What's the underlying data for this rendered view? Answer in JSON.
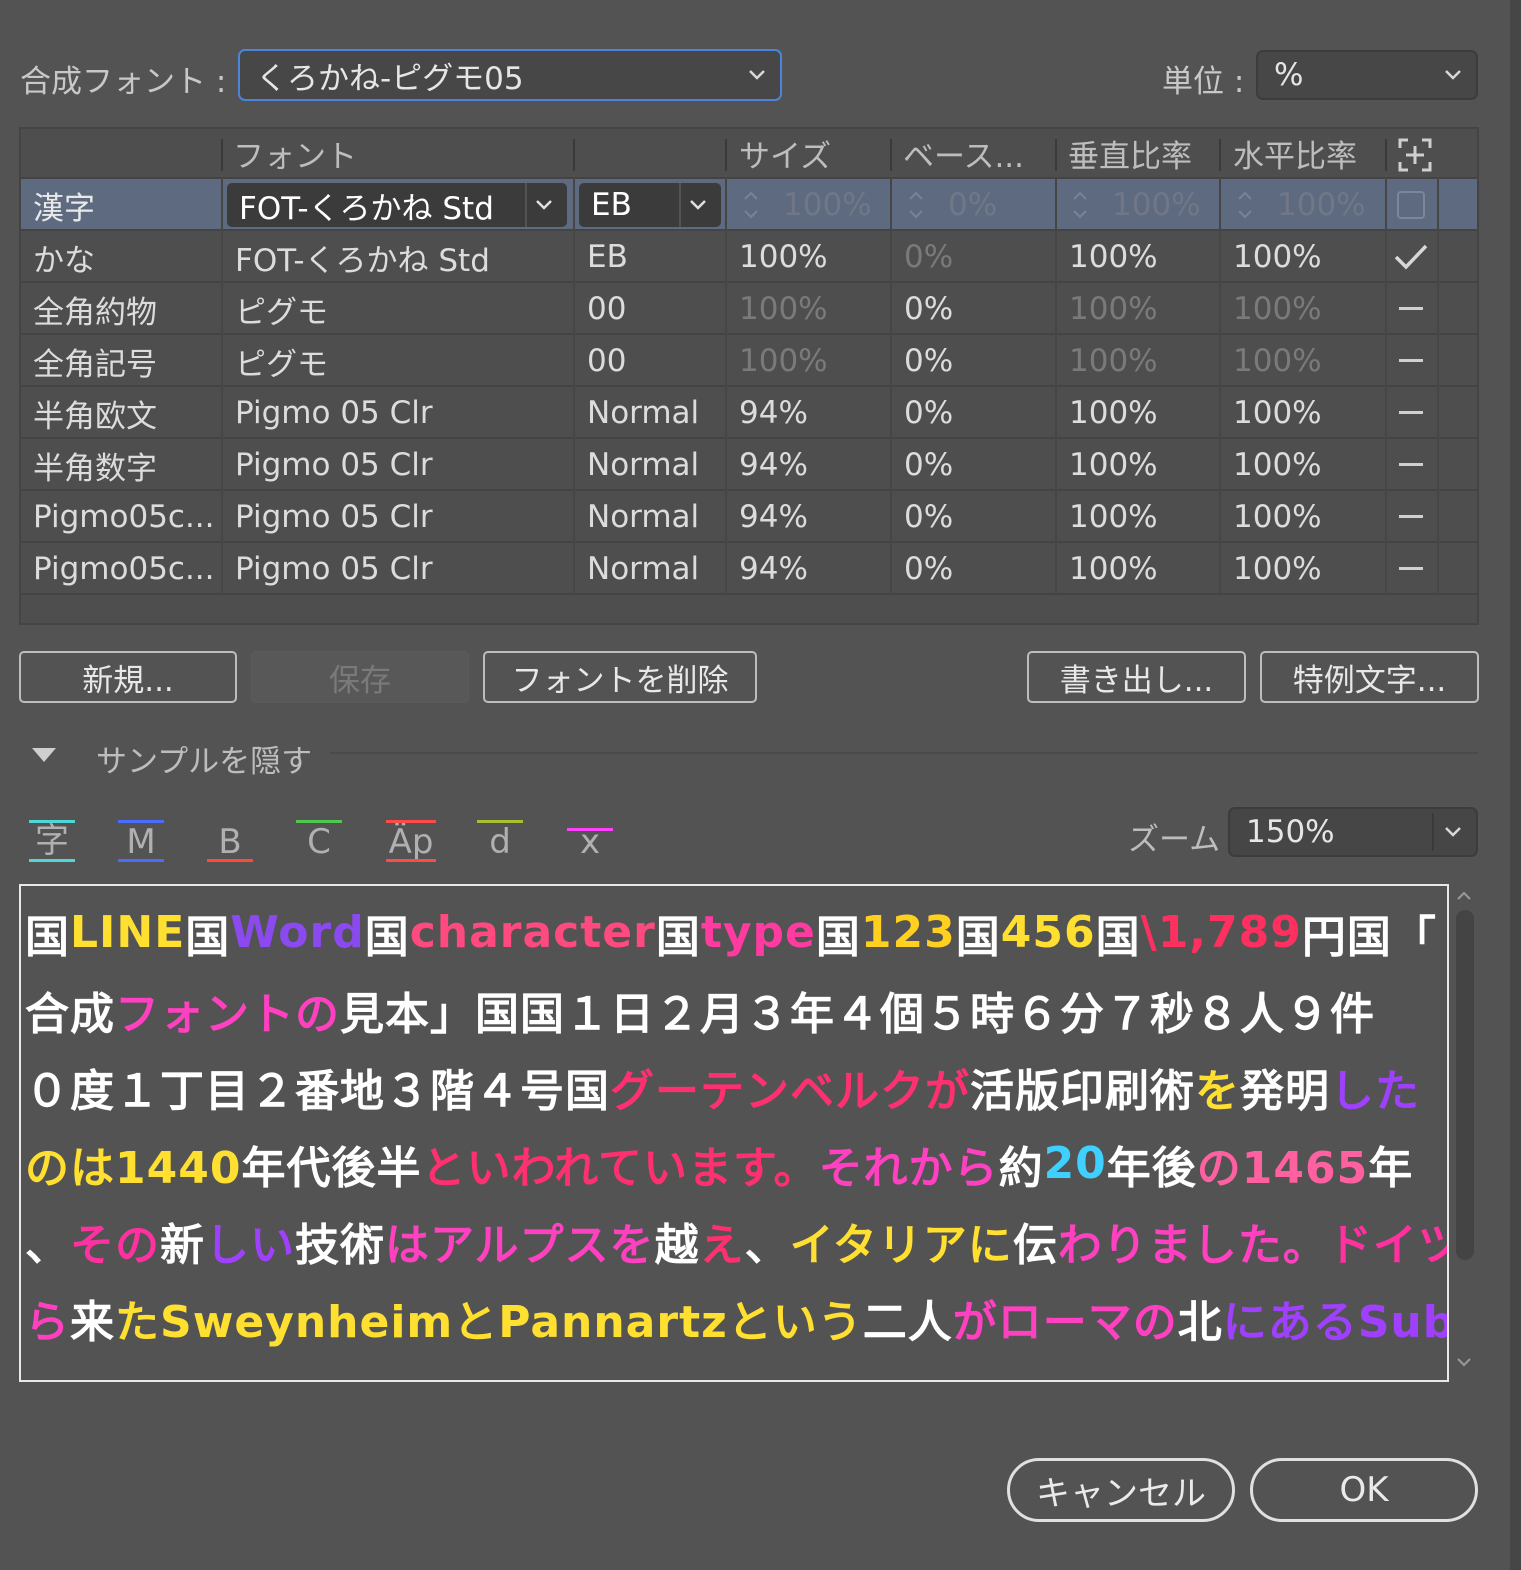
{
  "top": {
    "composite_font_label": "合成フォント :",
    "composite_font_value": "くろかね-ピグモ05",
    "unit_label": "単位 :",
    "unit_value": "%"
  },
  "table": {
    "headers": [
      "",
      "フォント",
      "",
      "サイズ",
      "ベース...",
      "垂直比率",
      "水平比率"
    ],
    "rows": [
      {
        "name": "漢字",
        "font": "FOT-くろかね Std",
        "style": "EB",
        "size": "100%",
        "base": "0%",
        "vscale": "100%",
        "hscale": "100%",
        "mark": "checkbox",
        "selected": true
      },
      {
        "name": "かな",
        "font": "FOT-くろかね Std",
        "style": "EB",
        "size": "100%",
        "base": "0%",
        "vscale": "100%",
        "hscale": "100%",
        "mark": "check"
      },
      {
        "name": "全角約物",
        "font": "ピグモ",
        "style": "00",
        "size": "100%",
        "base": "0%",
        "vscale": "100%",
        "hscale": "100%",
        "mark": "dash"
      },
      {
        "name": "全角記号",
        "font": "ピグモ",
        "style": "00",
        "size": "100%",
        "base": "0%",
        "vscale": "100%",
        "hscale": "100%",
        "mark": "dash"
      },
      {
        "name": "半角欧文",
        "font": "Pigmo 05 Clr",
        "style": "Normal",
        "size": "94%",
        "base": "0%",
        "vscale": "100%",
        "hscale": "100%",
        "mark": "dash"
      },
      {
        "name": "半角数字",
        "font": "Pigmo 05 Clr",
        "style": "Normal",
        "size": "94%",
        "base": "0%",
        "vscale": "100%",
        "hscale": "100%",
        "mark": "dash"
      },
      {
        "name": "Pigmo05c...",
        "font": "Pigmo 05 Clr",
        "style": "Normal",
        "size": "94%",
        "base": "0%",
        "vscale": "100%",
        "hscale": "100%",
        "mark": "dash"
      },
      {
        "name": "Pigmo05c...",
        "font": "Pigmo 05 Clr",
        "style": "Normal",
        "size": "94%",
        "base": "0%",
        "vscale": "100%",
        "hscale": "100%",
        "mark": "dash"
      }
    ]
  },
  "buttons": {
    "new": "新規...",
    "save": "保存",
    "delete_font": "フォントを削除",
    "export": "書き出し...",
    "special_chars": "特例文字..."
  },
  "sample": {
    "toggle_label": "サンプルを隠す",
    "tools": [
      "字",
      "M",
      "B",
      "C",
      "Äp",
      "d",
      "x"
    ],
    "zoom_label": "ズーム",
    "zoom_value": "150%",
    "lines": [
      [
        {
          "t": "国",
          "c": "#ffffff"
        },
        {
          "t": "LINE",
          "c": "#ffe030"
        },
        {
          "t": "国",
          "c": "#ffffff"
        },
        {
          "t": "Word",
          "c": "#8a4af0"
        },
        {
          "t": "国",
          "c": "#ffffff"
        },
        {
          "t": "character",
          "c": "#ff4a80"
        },
        {
          "t": "国",
          "c": "#ffffff"
        },
        {
          "t": "type",
          "c": "#ff3aa0"
        },
        {
          "t": "国",
          "c": "#ffffff"
        },
        {
          "t": "123",
          "c": "#ffd020"
        },
        {
          "t": "国",
          "c": "#ffffff"
        },
        {
          "t": "456",
          "c": "#ffe030"
        },
        {
          "t": "国",
          "c": "#ffffff"
        },
        {
          "t": "\\1,789",
          "c": "#ff3060"
        },
        {
          "t": "円国「",
          "c": "#ffffff"
        }
      ],
      [
        {
          "t": "合成",
          "c": "#ffffff"
        },
        {
          "t": "フォントの",
          "c": "#ff40c0"
        },
        {
          "t": "見本」国国１日２月３年４個５時６分７秒８人９件",
          "c": "#ffffff"
        }
      ],
      [
        {
          "t": "０度１丁目２番地３階４号国",
          "c": "#ffffff"
        },
        {
          "t": "グーテンベルクが",
          "c": "#ff3070"
        },
        {
          "t": "活版印刷術",
          "c": "#ffffff"
        },
        {
          "t": "を",
          "c": "#ffe030"
        },
        {
          "t": "発明",
          "c": "#ffffff"
        },
        {
          "t": "した",
          "c": "#a040ff"
        }
      ],
      [
        {
          "t": "のは1440",
          "c": "#ffe030"
        },
        {
          "t": "年代後半",
          "c": "#ffffff"
        },
        {
          "t": "といわれています。",
          "c": "#ff3070"
        },
        {
          "t": "それから",
          "c": "#ff40c0"
        },
        {
          "t": "約",
          "c": "#ffffff"
        },
        {
          "t": "20",
          "c": "#40d0ff"
        },
        {
          "t": "年後",
          "c": "#ffffff"
        },
        {
          "t": "の1465",
          "c": "#ff60a0"
        },
        {
          "t": "年",
          "c": "#ffffff"
        }
      ],
      [
        {
          "t": "、",
          "c": "#ffffff"
        },
        {
          "t": "その",
          "c": "#ff30a0"
        },
        {
          "t": "新",
          "c": "#ffffff"
        },
        {
          "t": "しい",
          "c": "#a040ff"
        },
        {
          "t": "技術",
          "c": "#ffffff"
        },
        {
          "t": "はアルプスを",
          "c": "#ff40c0"
        },
        {
          "t": "越",
          "c": "#ffffff"
        },
        {
          "t": "え",
          "c": "#ff3070"
        },
        {
          "t": "、",
          "c": "#ffffff"
        },
        {
          "t": "イタリアに",
          "c": "#ffe030"
        },
        {
          "t": "伝",
          "c": "#ffffff"
        },
        {
          "t": "わりました。",
          "c": "#ff40c0"
        },
        {
          "t": "ドイツか",
          "c": "#ff30a0"
        }
      ],
      [
        {
          "t": "ら",
          "c": "#ff40c0"
        },
        {
          "t": "来",
          "c": "#ffffff"
        },
        {
          "t": "たSweynheimとPannartzという",
          "c": "#ffe030"
        },
        {
          "t": "二人",
          "c": "#ffffff"
        },
        {
          "t": "がローマの",
          "c": "#ff40c0"
        },
        {
          "t": "北",
          "c": "#ffffff"
        },
        {
          "t": "にあるSubiacoと",
          "c": "#a040ff"
        }
      ]
    ]
  },
  "footer": {
    "cancel": "キャンセル",
    "ok": "OK"
  }
}
